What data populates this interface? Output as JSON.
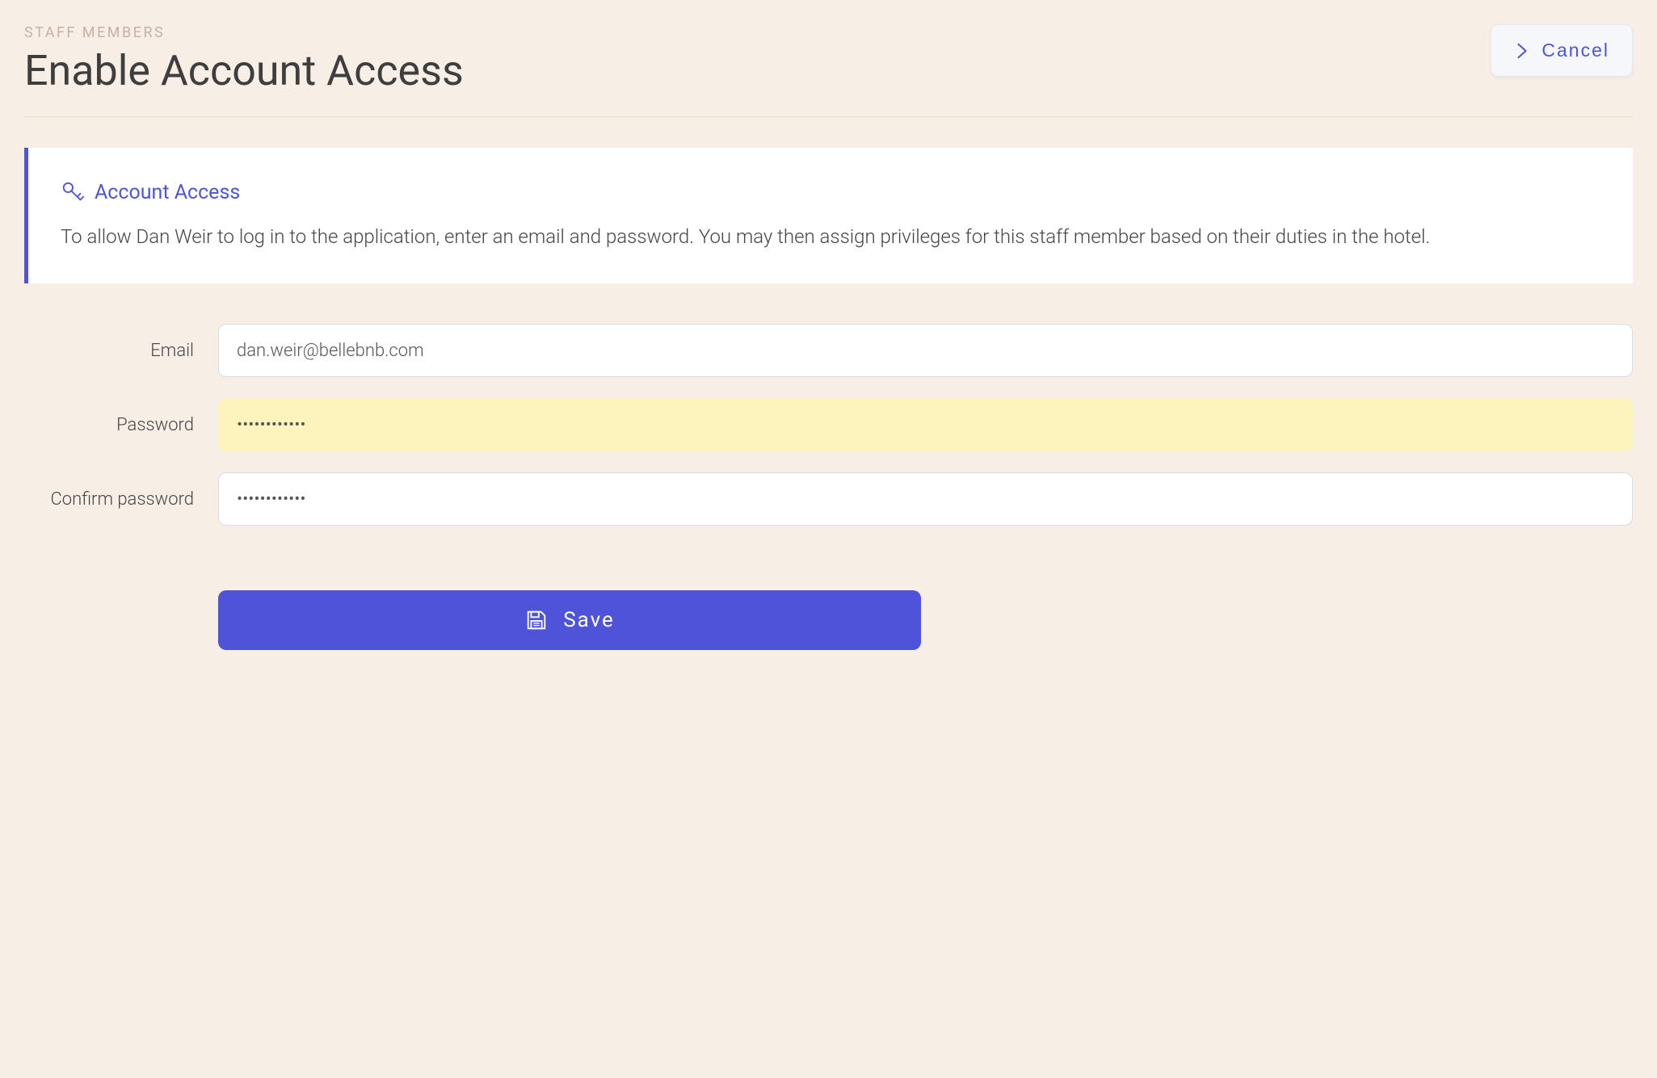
{
  "header": {
    "breadcrumb": "STAFF MEMBERS",
    "title": "Enable Account Access",
    "cancel_label": "Cancel"
  },
  "info_panel": {
    "title": "Account Access",
    "body": "To allow Dan Weir to log in to the application, enter an email and password. You may then assign privileges for this staff member based on their duties in the hotel."
  },
  "form": {
    "email": {
      "label": "Email",
      "value": "dan.weir@bellebnb.com"
    },
    "password": {
      "label": "Password",
      "value": "••••••••••••"
    },
    "confirm_password": {
      "label": "Confirm password",
      "value": "••••••••••••"
    }
  },
  "actions": {
    "save_label": "Save"
  },
  "colors": {
    "accent": "#4d54d8",
    "background": "#f7eee6",
    "panel_highlight": "#fdf3bd"
  }
}
